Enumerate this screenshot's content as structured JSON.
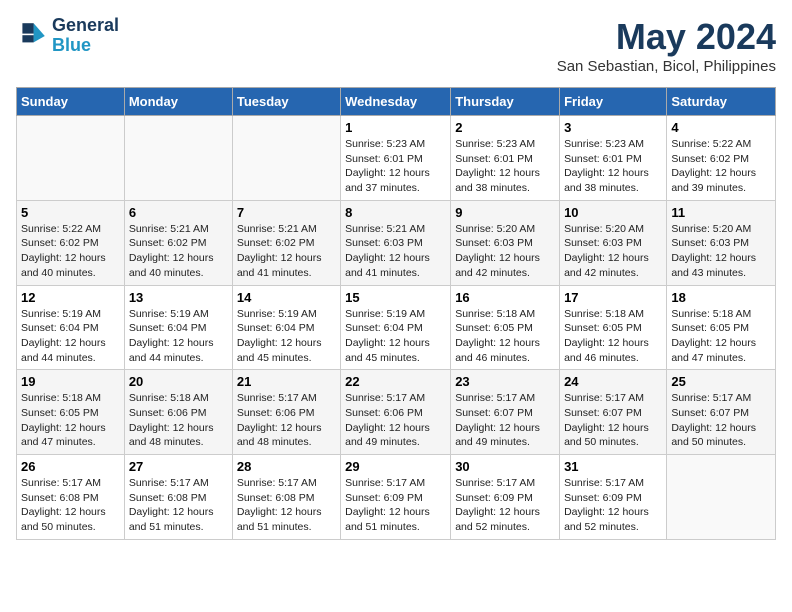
{
  "header": {
    "logo_line1": "General",
    "logo_line2": "Blue",
    "title": "May 2024",
    "subtitle": "San Sebastian, Bicol, Philippines"
  },
  "weekdays": [
    "Sunday",
    "Monday",
    "Tuesday",
    "Wednesday",
    "Thursday",
    "Friday",
    "Saturday"
  ],
  "weeks": [
    [
      {
        "day": "",
        "info": ""
      },
      {
        "day": "",
        "info": ""
      },
      {
        "day": "",
        "info": ""
      },
      {
        "day": "1",
        "info": "Sunrise: 5:23 AM\nSunset: 6:01 PM\nDaylight: 12 hours\nand 37 minutes."
      },
      {
        "day": "2",
        "info": "Sunrise: 5:23 AM\nSunset: 6:01 PM\nDaylight: 12 hours\nand 38 minutes."
      },
      {
        "day": "3",
        "info": "Sunrise: 5:23 AM\nSunset: 6:01 PM\nDaylight: 12 hours\nand 38 minutes."
      },
      {
        "day": "4",
        "info": "Sunrise: 5:22 AM\nSunset: 6:02 PM\nDaylight: 12 hours\nand 39 minutes."
      }
    ],
    [
      {
        "day": "5",
        "info": "Sunrise: 5:22 AM\nSunset: 6:02 PM\nDaylight: 12 hours\nand 40 minutes."
      },
      {
        "day": "6",
        "info": "Sunrise: 5:21 AM\nSunset: 6:02 PM\nDaylight: 12 hours\nand 40 minutes."
      },
      {
        "day": "7",
        "info": "Sunrise: 5:21 AM\nSunset: 6:02 PM\nDaylight: 12 hours\nand 41 minutes."
      },
      {
        "day": "8",
        "info": "Sunrise: 5:21 AM\nSunset: 6:03 PM\nDaylight: 12 hours\nand 41 minutes."
      },
      {
        "day": "9",
        "info": "Sunrise: 5:20 AM\nSunset: 6:03 PM\nDaylight: 12 hours\nand 42 minutes."
      },
      {
        "day": "10",
        "info": "Sunrise: 5:20 AM\nSunset: 6:03 PM\nDaylight: 12 hours\nand 42 minutes."
      },
      {
        "day": "11",
        "info": "Sunrise: 5:20 AM\nSunset: 6:03 PM\nDaylight: 12 hours\nand 43 minutes."
      }
    ],
    [
      {
        "day": "12",
        "info": "Sunrise: 5:19 AM\nSunset: 6:04 PM\nDaylight: 12 hours\nand 44 minutes."
      },
      {
        "day": "13",
        "info": "Sunrise: 5:19 AM\nSunset: 6:04 PM\nDaylight: 12 hours\nand 44 minutes."
      },
      {
        "day": "14",
        "info": "Sunrise: 5:19 AM\nSunset: 6:04 PM\nDaylight: 12 hours\nand 45 minutes."
      },
      {
        "day": "15",
        "info": "Sunrise: 5:19 AM\nSunset: 6:04 PM\nDaylight: 12 hours\nand 45 minutes."
      },
      {
        "day": "16",
        "info": "Sunrise: 5:18 AM\nSunset: 6:05 PM\nDaylight: 12 hours\nand 46 minutes."
      },
      {
        "day": "17",
        "info": "Sunrise: 5:18 AM\nSunset: 6:05 PM\nDaylight: 12 hours\nand 46 minutes."
      },
      {
        "day": "18",
        "info": "Sunrise: 5:18 AM\nSunset: 6:05 PM\nDaylight: 12 hours\nand 47 minutes."
      }
    ],
    [
      {
        "day": "19",
        "info": "Sunrise: 5:18 AM\nSunset: 6:05 PM\nDaylight: 12 hours\nand 47 minutes."
      },
      {
        "day": "20",
        "info": "Sunrise: 5:18 AM\nSunset: 6:06 PM\nDaylight: 12 hours\nand 48 minutes."
      },
      {
        "day": "21",
        "info": "Sunrise: 5:17 AM\nSunset: 6:06 PM\nDaylight: 12 hours\nand 48 minutes."
      },
      {
        "day": "22",
        "info": "Sunrise: 5:17 AM\nSunset: 6:06 PM\nDaylight: 12 hours\nand 49 minutes."
      },
      {
        "day": "23",
        "info": "Sunrise: 5:17 AM\nSunset: 6:07 PM\nDaylight: 12 hours\nand 49 minutes."
      },
      {
        "day": "24",
        "info": "Sunrise: 5:17 AM\nSunset: 6:07 PM\nDaylight: 12 hours\nand 50 minutes."
      },
      {
        "day": "25",
        "info": "Sunrise: 5:17 AM\nSunset: 6:07 PM\nDaylight: 12 hours\nand 50 minutes."
      }
    ],
    [
      {
        "day": "26",
        "info": "Sunrise: 5:17 AM\nSunset: 6:08 PM\nDaylight: 12 hours\nand 50 minutes."
      },
      {
        "day": "27",
        "info": "Sunrise: 5:17 AM\nSunset: 6:08 PM\nDaylight: 12 hours\nand 51 minutes."
      },
      {
        "day": "28",
        "info": "Sunrise: 5:17 AM\nSunset: 6:08 PM\nDaylight: 12 hours\nand 51 minutes."
      },
      {
        "day": "29",
        "info": "Sunrise: 5:17 AM\nSunset: 6:09 PM\nDaylight: 12 hours\nand 51 minutes."
      },
      {
        "day": "30",
        "info": "Sunrise: 5:17 AM\nSunset: 6:09 PM\nDaylight: 12 hours\nand 52 minutes."
      },
      {
        "day": "31",
        "info": "Sunrise: 5:17 AM\nSunset: 6:09 PM\nDaylight: 12 hours\nand 52 minutes."
      },
      {
        "day": "",
        "info": ""
      }
    ]
  ]
}
